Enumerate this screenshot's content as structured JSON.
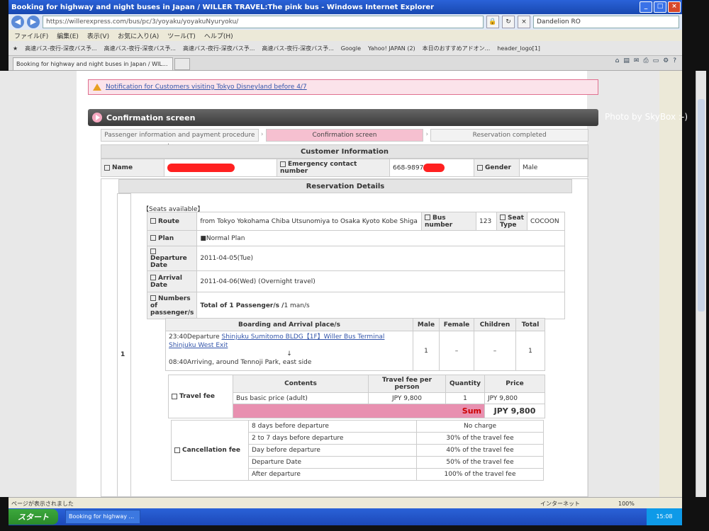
{
  "window": {
    "title": "Booking for highway and night buses in Japan / WILLER TRAVEL:The pink bus - Windows Internet Explorer"
  },
  "address": {
    "url": "https://willerexpress.com/bus/pc/3/yoyaku/yoyakuNyuryoku/",
    "search": "Dandelion RO"
  },
  "menu": [
    "ファイル(F)",
    "編集(E)",
    "表示(V)",
    "お気に入り(A)",
    "ツール(T)",
    "ヘルプ(H)"
  ],
  "favorites": [
    "高速バス-夜行-深夜バス予...",
    "高速バス-夜行-深夜バス予...",
    "高速バス-夜行-深夜バス予...",
    "高速バス-夜行-深夜バス予...",
    "Google",
    "Yahoo! JAPAN (2)",
    "本日のおすすめアドオン...",
    "header_logo[1]"
  ],
  "tab": {
    "label": "Booking for highway and night buses in Japan / WIL..."
  },
  "notice": {
    "text": "Notification for Customers visiting Tokyo Disneyland before 4/7"
  },
  "confirmation": {
    "title": "Confirmation screen",
    "watermark": "Photo by  SkyBox :-)"
  },
  "steps": [
    "Passenger information and payment procedure entry screen",
    "Confirmation screen",
    "Reservation completed"
  ],
  "customer": {
    "header": "Customer Information",
    "name_label": "Name",
    "emergency_label": "Emergency contact number",
    "emergency_value": "668-9897",
    "gender_label": "Gender",
    "gender_value": "Male"
  },
  "reservation": {
    "header": "Reservation Details",
    "seats": "【Seats available】",
    "route_label": "Route",
    "route_value": "from Tokyo Yokohama Chiba Utsunomiya to Osaka Kyoto Kobe Shiga",
    "bus_label": "Bus number",
    "bus_value": "123",
    "seat_label": "Seat Type",
    "seat_value": "COCOON",
    "plan_label": "Plan",
    "plan_value": "■Normal Plan",
    "departure_label": "Departure Date",
    "departure_value": "2011-04-05(Tue)",
    "arrival_label": "Arrival Date",
    "arrival_value": "2011-04-06(Wed)  (Overnight travel)",
    "passengers_label": "Numbers of passenger/s",
    "passengers_value": "Total of 1 Passenger/s /",
    "passengers_sub": "1 man/s",
    "row_index": "1",
    "boarding_header": "Boarding and Arrival place/s",
    "male": "Male",
    "female": "Female",
    "children": "Children",
    "total": "Total",
    "dep_time": "23:40Departure",
    "dep_place": "Shinjuku Sumitomo BLDG【1F】Willer Bus Terminal Shinjuku West Exit",
    "down_arrow": "↓",
    "arr_time": "08:40Arriving, around",
    "arr_place": "Tennoji Park, east side",
    "male_count": "1",
    "female_count": "–",
    "children_count": "–",
    "total_count": "1"
  },
  "fee": {
    "label": "Travel fee",
    "contents": "Contents",
    "per_person": "Travel fee per person",
    "quantity": "Quantity",
    "price": "Price",
    "item": "Bus basic price (adult)",
    "item_per": "JPY 9,800",
    "item_qty": "1",
    "item_price": "JPY 9,800",
    "sum_label": "Sum",
    "sum_value": "JPY 9,800"
  },
  "cancellation": {
    "label": "Cancellation fee",
    "rows": [
      {
        "when": "8 days before departure",
        "fee": "No charge"
      },
      {
        "when": "2 to 7 days before departure",
        "fee": "30% of the travel fee"
      },
      {
        "when": "Day before departure",
        "fee": "40% of the travel fee"
      },
      {
        "when": "Departure Date",
        "fee": "50% of the travel fee"
      },
      {
        "when": "After departure",
        "fee": "100% of the travel fee"
      }
    ]
  },
  "status": {
    "left": "ページが表示されました",
    "zone": "インターネット",
    "zoom": "100%"
  },
  "taskbar": {
    "start": "スタート",
    "item": "Booking for highway ...",
    "clock": "15:08"
  }
}
